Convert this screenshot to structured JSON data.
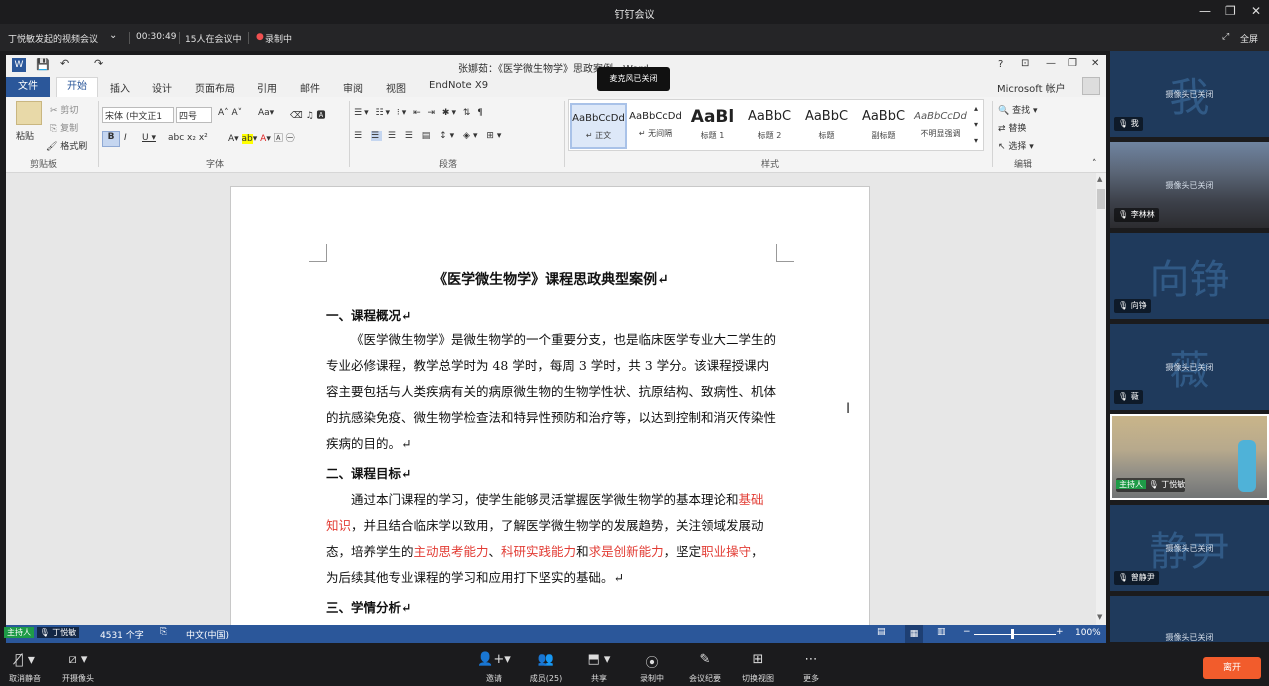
{
  "window": {
    "title": "钉钉会议"
  },
  "meeting": {
    "title": "丁悦敏发起的视频会议",
    "timer": "00:30:49",
    "participants": "15人在会议中",
    "recording": "录制中",
    "fullscreen": "全屏"
  },
  "tooltip": "麦克风已关闭",
  "word": {
    "title": "张娜茹：《医学微生物学》思政案例 - Word",
    "help": "?",
    "account": "Microsoft 帐户",
    "tabs": [
      "文件",
      "开始",
      "插入",
      "设计",
      "页面布局",
      "引用",
      "邮件",
      "审阅",
      "视图",
      "EndNote X9"
    ],
    "clipboard": {
      "paste": "粘贴",
      "cut": "剪切",
      "copy": "复制",
      "format": "格式刷",
      "group": "剪贴板"
    },
    "font": {
      "name": "宋体 (中文正1",
      "size": "四号",
      "group": "字体"
    },
    "paragraph_group": "段落",
    "styles": [
      {
        "preview": "AaBbCcDd",
        "name": "↵ 正文"
      },
      {
        "preview": "AaBbCcDd",
        "name": "↵ 无间隔"
      },
      {
        "preview": "AaBl",
        "name": "标题 1"
      },
      {
        "preview": "AaBbC",
        "name": "标题 2"
      },
      {
        "preview": "AaBbC",
        "name": "标题"
      },
      {
        "preview": "AaBbC",
        "name": "副标题"
      },
      {
        "preview": "AaBbCcDd",
        "name": "不明显强调"
      }
    ],
    "styles_group": "样式",
    "editing": {
      "find": "查找",
      "replace": "替换",
      "select": "选择",
      "group": "编辑"
    },
    "status": {
      "words": "4531 个字",
      "lang": "中文(中国)",
      "zoom": "100%"
    }
  },
  "doc": {
    "title": "《医学微生物学》课程思政典型案例",
    "h1": "一、课程概况",
    "p1": "《医学微生物学》是微生物学的一个重要分支，也是临床医学专业大二学生的专业必修课程，教学总学时为 48 学时，每周 3 学时，共 3 学分。该课程授课内容主要包括与人类疾病有关的病原微生物的生物学性状、抗原结构、致病性、机体的抗感染免疫、微生物学检查法和特异性预防和治疗等，以达到控制和消灭传染性疾病的目的。",
    "h2": "二、课程目标",
    "p2a": "通过本门课程的学习，使学生能够灵活掌握医学微生物学的基本理论和",
    "p2r1": "基础知识",
    "p2b": "，并且结合临床学以致用，了解医学微生物学的发展趋势，关注领域发展动态，培养学生的",
    "p2r2": "主动思考能力",
    "p2c": "、",
    "p2r3": "科研实践能力",
    "p2d": "和",
    "p2r4": "求是创新能力",
    "p2e": "，坚定",
    "p2r5": "职业操守",
    "p2f": "，为后续其他专业课程的学习和应用打下坚实的基础。",
    "h3": "三、学情分析"
  },
  "host_tag": {
    "role": "主持人",
    "name": "丁悦敏"
  },
  "sidebar": [
    {
      "big": "我",
      "cam": "摄像头已关闭",
      "name": "我"
    },
    {
      "big": "",
      "cam": "摄像头已关闭",
      "name": "李林林"
    },
    {
      "big": "向铮",
      "cam": "",
      "name": "向铮"
    },
    {
      "big": "薇",
      "cam": "摄像头已关闭",
      "name": "薇"
    },
    {
      "big": "",
      "cam": "",
      "name": "丁悦敏",
      "role": "主持人"
    },
    {
      "big": "静尹",
      "cam": "摄像头已关闭",
      "name": "曾静尹"
    },
    {
      "big": "",
      "cam": "摄像头已关闭",
      "name": ""
    }
  ],
  "toolbar": {
    "mute": "取消静音",
    "camera": "开摄像头",
    "invite": "邀请",
    "members": "成员(25)",
    "share": "共享",
    "record": "录制中",
    "minutes": "会议纪要",
    "view": "切换视图",
    "more": "更多",
    "leave": "离开"
  },
  "colors": {
    "word_blue": "#2b579a",
    "leave": "#f25c2c",
    "red_text": "#e23c34",
    "host_green": "#1e9b47"
  }
}
